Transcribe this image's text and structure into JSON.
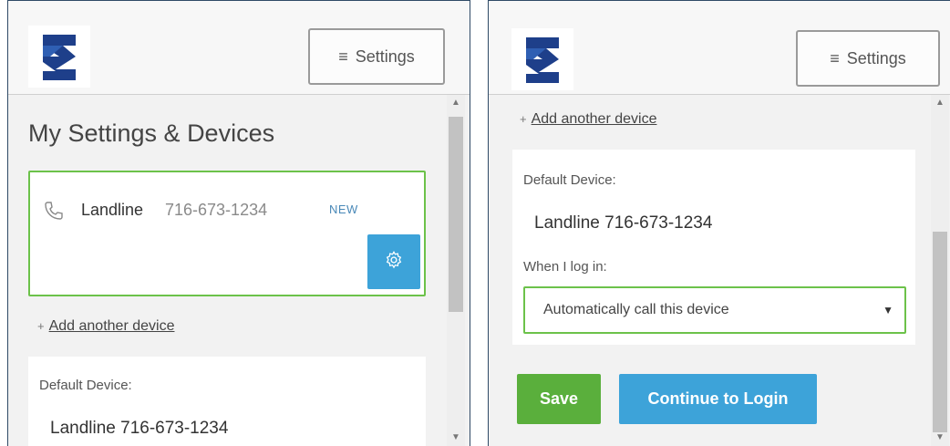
{
  "header": {
    "settings_label": "Settings",
    "logo_icon": "company-logo-icon"
  },
  "left": {
    "page_title": "My Settings & Devices",
    "device": {
      "type": "Landline",
      "number": "716-673-1234",
      "badge": "NEW",
      "icon": "phone-icon",
      "settings_icon": "gear-icon"
    },
    "add_device": {
      "prefix": "+",
      "label": "Add another device"
    },
    "default_device": {
      "label": "Default Device:",
      "value": "Landline 716-673-1234"
    }
  },
  "right": {
    "add_device": {
      "prefix": "+",
      "label": "Add another device"
    },
    "default_device": {
      "label": "Default Device:",
      "value": "Landline 716-673-1234"
    },
    "login_label": "When I log in:",
    "login_option": "Automatically call this device",
    "save_label": "Save",
    "continue_label": "Continue to Login"
  },
  "colors": {
    "accent_blue": "#3da3d9",
    "accent_green": "#5aaf3c",
    "border_green": "#6cc24a",
    "logo_navy": "#1e3f8a"
  }
}
